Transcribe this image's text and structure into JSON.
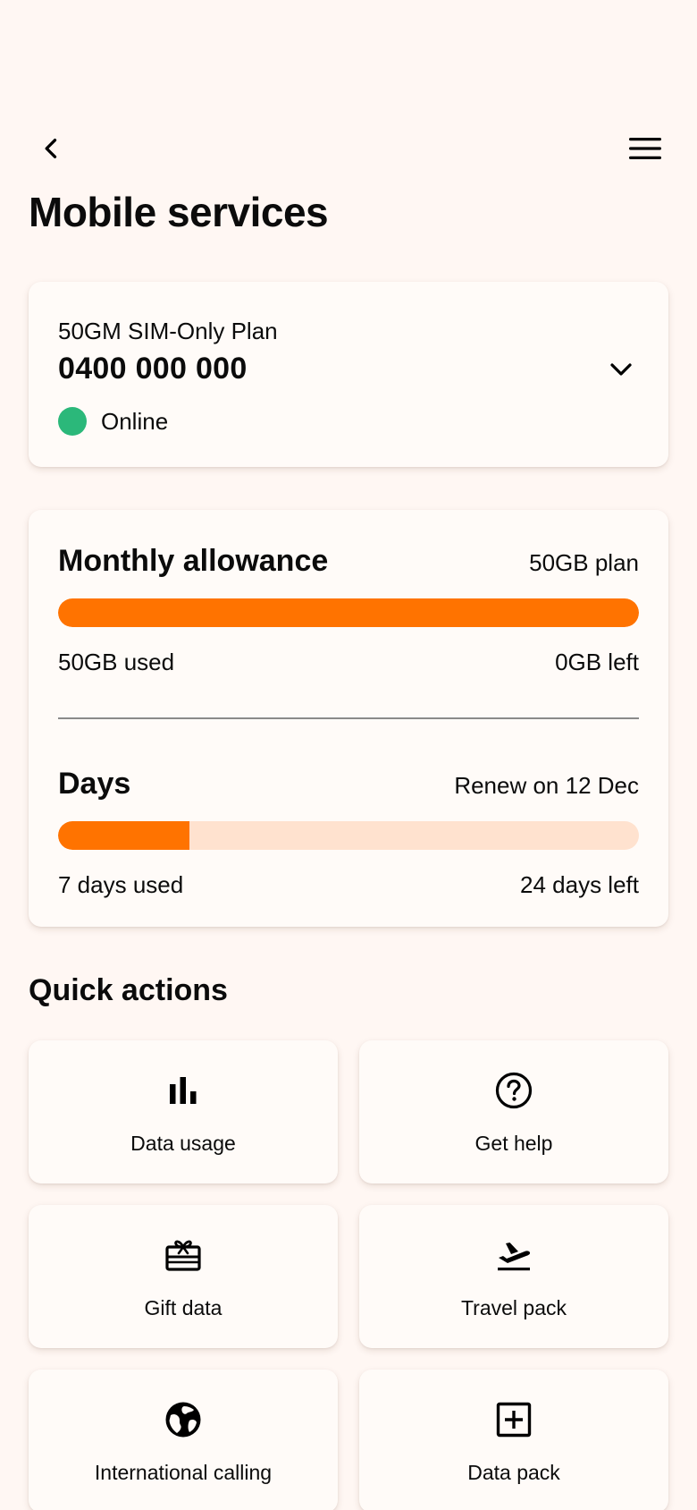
{
  "header": {
    "back_icon": "chevron-left-icon",
    "menu_icon": "hamburger-menu-icon",
    "title": "Mobile services"
  },
  "plan": {
    "name": "50GM SIM-Only Plan",
    "number": "0400 000 000",
    "status": "Online",
    "status_color": "#2bb87a",
    "expand_icon": "chevron-down-icon"
  },
  "allowance": {
    "title": "Monthly allowance",
    "plan_label": "50GB plan",
    "used_label": "50GB used",
    "left_label": "0GB left",
    "used_fraction": 1.0
  },
  "days": {
    "title": "Days",
    "renew_label": "Renew on 12 Dec",
    "used_label": "7 days used",
    "left_label": "24 days left",
    "used_fraction": 0.2258
  },
  "colors": {
    "accent": "#ff7300",
    "track": "#ffe2cf",
    "background": "#fff7f3",
    "card": "#fffbf8"
  },
  "quick_actions": {
    "title": "Quick actions",
    "items": [
      {
        "label": "Data usage",
        "icon": "bar-chart-icon"
      },
      {
        "label": "Get help",
        "icon": "question-circle-icon"
      },
      {
        "label": "Gift data",
        "icon": "gift-icon"
      },
      {
        "label": "Travel pack",
        "icon": "airplane-takeoff-icon"
      },
      {
        "label": "International calling",
        "icon": "globe-icon"
      },
      {
        "label": "Data pack",
        "icon": "plus-square-icon"
      }
    ]
  }
}
